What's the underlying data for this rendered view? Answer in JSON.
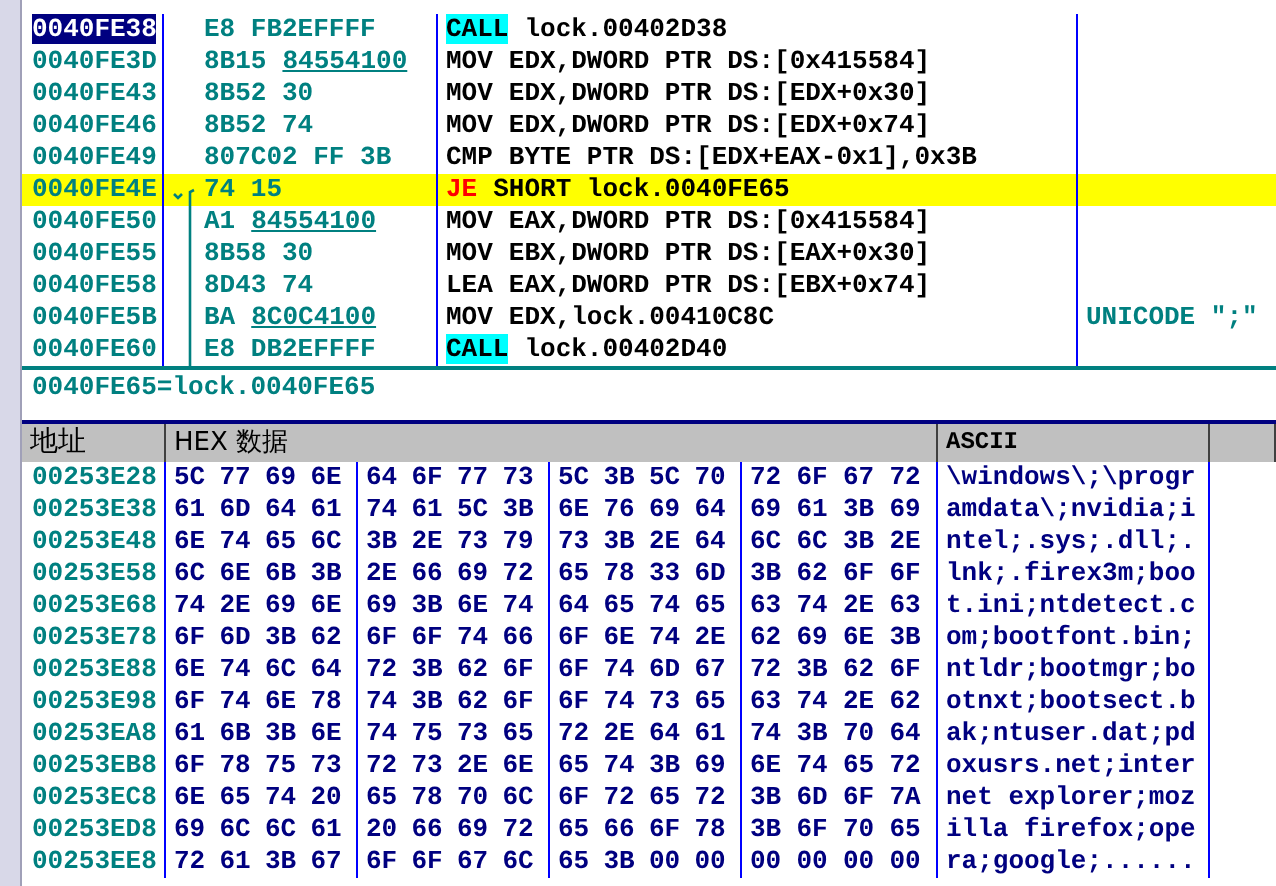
{
  "disassembly": {
    "rows": [
      {
        "address": "0040FE38",
        "selected": true,
        "highlighted": false,
        "jump_start": false,
        "jump_through": false,
        "hex": "E8 FB2EFFFF",
        "hex_ref": "",
        "kind": "call",
        "mnemonic": "CALL",
        "operands": "lock.00402D38",
        "comment": ""
      },
      {
        "address": "0040FE3D",
        "selected": false,
        "highlighted": false,
        "jump_start": false,
        "jump_through": false,
        "hex": "8B15",
        "hex_ref": "84554100",
        "kind": "plain",
        "mnemonic": "MOV",
        "operands": "EDX,DWORD PTR DS:[0x415584]",
        "comment": ""
      },
      {
        "address": "0040FE43",
        "selected": false,
        "highlighted": false,
        "jump_start": false,
        "jump_through": false,
        "hex": "8B52 30",
        "hex_ref": "",
        "kind": "plain",
        "mnemonic": "MOV",
        "operands": "EDX,DWORD PTR DS:[EDX+0x30]",
        "comment": ""
      },
      {
        "address": "0040FE46",
        "selected": false,
        "highlighted": false,
        "jump_start": false,
        "jump_through": false,
        "hex": "8B52 74",
        "hex_ref": "",
        "kind": "plain",
        "mnemonic": "MOV",
        "operands": "EDX,DWORD PTR DS:[EDX+0x74]",
        "comment": ""
      },
      {
        "address": "0040FE49",
        "selected": false,
        "highlighted": false,
        "jump_start": false,
        "jump_through": false,
        "hex": "807C02 FF 3B",
        "hex_ref": "",
        "kind": "plain",
        "mnemonic": "CMP",
        "operands": "BYTE PTR DS:[EDX+EAX-0x1],0x3B",
        "comment": ""
      },
      {
        "address": "0040FE4E",
        "selected": false,
        "highlighted": true,
        "jump_start": true,
        "jump_through": false,
        "hex": "74 15",
        "hex_ref": "",
        "kind": "jump",
        "mnemonic": "JE",
        "operands": "SHORT lock.0040FE65",
        "comment": ""
      },
      {
        "address": "0040FE50",
        "selected": false,
        "highlighted": false,
        "jump_start": false,
        "jump_through": true,
        "hex": "A1",
        "hex_ref": "84554100",
        "kind": "plain",
        "mnemonic": "MOV",
        "operands": "EAX,DWORD PTR DS:[0x415584]",
        "comment": ""
      },
      {
        "address": "0040FE55",
        "selected": false,
        "highlighted": false,
        "jump_start": false,
        "jump_through": true,
        "hex": "8B58 30",
        "hex_ref": "",
        "kind": "plain",
        "mnemonic": "MOV",
        "operands": "EBX,DWORD PTR DS:[EAX+0x30]",
        "comment": ""
      },
      {
        "address": "0040FE58",
        "selected": false,
        "highlighted": false,
        "jump_start": false,
        "jump_through": true,
        "hex": "8D43 74",
        "hex_ref": "",
        "kind": "plain",
        "mnemonic": "LEA",
        "operands": "EAX,DWORD PTR DS:[EBX+0x74]",
        "comment": ""
      },
      {
        "address": "0040FE5B",
        "selected": false,
        "highlighted": false,
        "jump_start": false,
        "jump_through": true,
        "hex": "BA",
        "hex_ref": "8C0C4100",
        "kind": "plain",
        "mnemonic": "MOV",
        "operands": "EDX,lock.00410C8C",
        "comment": "UNICODE \";\""
      },
      {
        "address": "0040FE60",
        "selected": false,
        "highlighted": false,
        "jump_start": false,
        "jump_through": true,
        "hex": "E8 DB2EFFFF",
        "hex_ref": "",
        "kind": "call",
        "mnemonic": "CALL",
        "operands": "lock.00402D40",
        "comment": ""
      }
    ]
  },
  "info_line": "0040FE65=lock.0040FE65",
  "dump": {
    "columns": [
      "地址",
      "HEX 数据",
      "ASCII"
    ],
    "rows": [
      {
        "address": "00253E28",
        "bytes": [
          "5C",
          "77",
          "69",
          "6E",
          "64",
          "6F",
          "77",
          "73",
          "5C",
          "3B",
          "5C",
          "70",
          "72",
          "6F",
          "67",
          "72"
        ],
        "ascii": "\\windows\\;\\progr"
      },
      {
        "address": "00253E38",
        "bytes": [
          "61",
          "6D",
          "64",
          "61",
          "74",
          "61",
          "5C",
          "3B",
          "6E",
          "76",
          "69",
          "64",
          "69",
          "61",
          "3B",
          "69"
        ],
        "ascii": "amdata\\;nvidia;i"
      },
      {
        "address": "00253E48",
        "bytes": [
          "6E",
          "74",
          "65",
          "6C",
          "3B",
          "2E",
          "73",
          "79",
          "73",
          "3B",
          "2E",
          "64",
          "6C",
          "6C",
          "3B",
          "2E"
        ],
        "ascii": "ntel;.sys;.dll;."
      },
      {
        "address": "00253E58",
        "bytes": [
          "6C",
          "6E",
          "6B",
          "3B",
          "2E",
          "66",
          "69",
          "72",
          "65",
          "78",
          "33",
          "6D",
          "3B",
          "62",
          "6F",
          "6F"
        ],
        "ascii": "lnk;.firex3m;boo"
      },
      {
        "address": "00253E68",
        "bytes": [
          "74",
          "2E",
          "69",
          "6E",
          "69",
          "3B",
          "6E",
          "74",
          "64",
          "65",
          "74",
          "65",
          "63",
          "74",
          "2E",
          "63"
        ],
        "ascii": "t.ini;ntdetect.c"
      },
      {
        "address": "00253E78",
        "bytes": [
          "6F",
          "6D",
          "3B",
          "62",
          "6F",
          "6F",
          "74",
          "66",
          "6F",
          "6E",
          "74",
          "2E",
          "62",
          "69",
          "6E",
          "3B"
        ],
        "ascii": "om;bootfont.bin;"
      },
      {
        "address": "00253E88",
        "bytes": [
          "6E",
          "74",
          "6C",
          "64",
          "72",
          "3B",
          "62",
          "6F",
          "6F",
          "74",
          "6D",
          "67",
          "72",
          "3B",
          "62",
          "6F"
        ],
        "ascii": "ntldr;bootmgr;bo"
      },
      {
        "address": "00253E98",
        "bytes": [
          "6F",
          "74",
          "6E",
          "78",
          "74",
          "3B",
          "62",
          "6F",
          "6F",
          "74",
          "73",
          "65",
          "63",
          "74",
          "2E",
          "62"
        ],
        "ascii": "otnxt;bootsect.b"
      },
      {
        "address": "00253EA8",
        "bytes": [
          "61",
          "6B",
          "3B",
          "6E",
          "74",
          "75",
          "73",
          "65",
          "72",
          "2E",
          "64",
          "61",
          "74",
          "3B",
          "70",
          "64"
        ],
        "ascii": "ak;ntuser.dat;pd"
      },
      {
        "address": "00253EB8",
        "bytes": [
          "6F",
          "78",
          "75",
          "73",
          "72",
          "73",
          "2E",
          "6E",
          "65",
          "74",
          "3B",
          "69",
          "6E",
          "74",
          "65",
          "72"
        ],
        "ascii": "oxusrs.net;inter"
      },
      {
        "address": "00253EC8",
        "bytes": [
          "6E",
          "65",
          "74",
          "20",
          "65",
          "78",
          "70",
          "6C",
          "6F",
          "72",
          "65",
          "72",
          "3B",
          "6D",
          "6F",
          "7A"
        ],
        "ascii": "net explorer;moz"
      },
      {
        "address": "00253ED8",
        "bytes": [
          "69",
          "6C",
          "6C",
          "61",
          "20",
          "66",
          "69",
          "72",
          "65",
          "66",
          "6F",
          "78",
          "3B",
          "6F",
          "70",
          "65"
        ],
        "ascii": "illa firefox;ope"
      },
      {
        "address": "00253EE8",
        "bytes": [
          "72",
          "61",
          "3B",
          "67",
          "6F",
          "6F",
          "67",
          "6C",
          "65",
          "3B",
          "00",
          "00",
          "00",
          "00",
          "00",
          "00"
        ],
        "ascii": "ra;google;......"
      }
    ]
  }
}
